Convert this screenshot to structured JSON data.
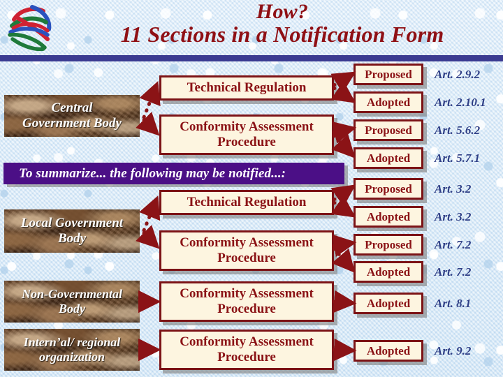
{
  "slide": {
    "title_line1": "How?",
    "title_line2": "11 Sections in a Notification Form",
    "logo_name": "wto-logo",
    "colors": {
      "title_red": "#8f1015",
      "rule_blue": "#3b3b91",
      "box_border_red": "#7c1316",
      "box_fill_cream": "#fdf5e0",
      "banner_purple": "#4b0f86",
      "article_blue": "#2f3f86",
      "body_brown": "#5c3a22",
      "background_blue": "#d9e9f7"
    }
  },
  "banner": {
    "text": "To summarize... the following may be notified...:"
  },
  "bodies": [
    {
      "id": "central-government-body",
      "label": "Central\nGovernment Body"
    },
    {
      "id": "local-government-body",
      "label": "Local Government\nBody"
    },
    {
      "id": "non-governmental-body",
      "label": "Non-Governmental\nBody"
    },
    {
      "id": "international-regional-org",
      "label": "Intern’al/ regional\norganization"
    }
  ],
  "instruments": [
    {
      "id": "tr-central",
      "label": "Technical Regulation"
    },
    {
      "id": "cap-central",
      "label": "Conformity Assessment\nProcedure"
    },
    {
      "id": "tr-local",
      "label": "Technical Regulation"
    },
    {
      "id": "cap-local",
      "label": "Conformity Assessment\nProcedure"
    },
    {
      "id": "cap-ngb",
      "label": "Conformity Assessment\nProcedure"
    },
    {
      "id": "cap-intl",
      "label": "Conformity Assessment\nProcedure"
    }
  ],
  "stages": [
    {
      "id": "stage-1",
      "label": "Proposed",
      "article": "Art. 2.9.2"
    },
    {
      "id": "stage-2",
      "label": "Adopted",
      "article": "Art. 2.10.1"
    },
    {
      "id": "stage-3",
      "label": "Proposed",
      "article": "Art. 5.6.2"
    },
    {
      "id": "stage-4",
      "label": "Adopted",
      "article": "Art. 5.7.1"
    },
    {
      "id": "stage-5",
      "label": "Proposed",
      "article": "Art. 3.2"
    },
    {
      "id": "stage-6",
      "label": "Adopted",
      "article": "Art. 3.2"
    },
    {
      "id": "stage-7",
      "label": "Proposed",
      "article": "Art. 7.2"
    },
    {
      "id": "stage-8",
      "label": "Adopted",
      "article": "Art. 7.2"
    },
    {
      "id": "stage-9",
      "label": "Adopted",
      "article": "Art. 8.1"
    },
    {
      "id": "stage-10",
      "label": "Adopted",
      "article": "Art. 9.2"
    }
  ]
}
